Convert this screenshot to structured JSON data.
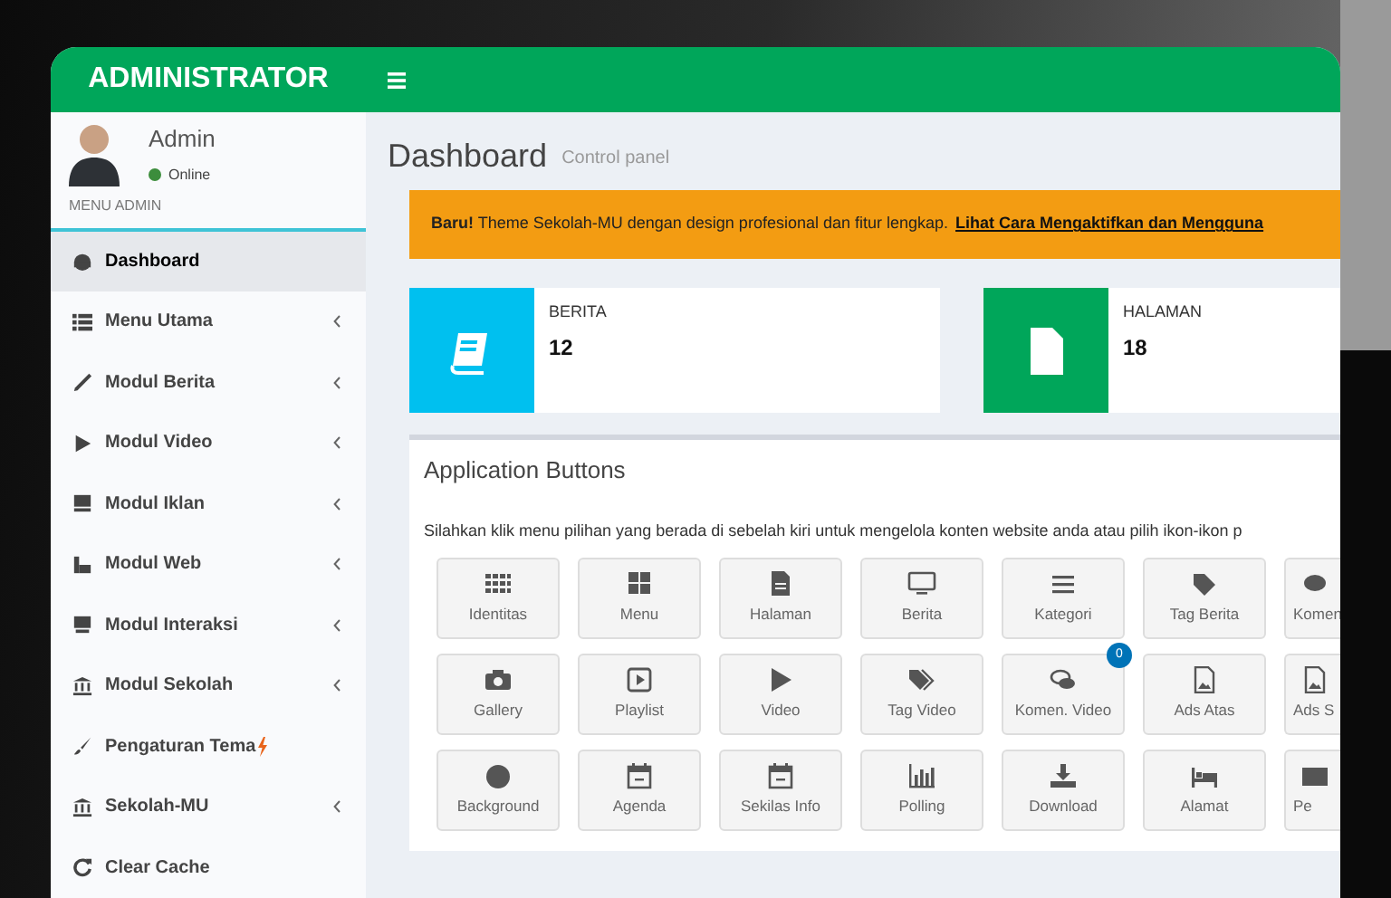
{
  "header": {
    "logo": "ADMINISTRATOR"
  },
  "user": {
    "name": "Admin",
    "status": "Online",
    "online": true
  },
  "sidebar": {
    "heading": "MENU ADMIN",
    "items": [
      {
        "label": "Dashboard",
        "kind": "link",
        "selected": true
      },
      {
        "label": "Menu Utama",
        "kind": "group",
        "selected": false
      },
      {
        "label": "Modul Berita",
        "kind": "group",
        "selected": false
      },
      {
        "label": "Modul Video",
        "kind": "group",
        "selected": false
      },
      {
        "label": "Modul Iklan",
        "kind": "group",
        "selected": false
      },
      {
        "label": "Modul Web",
        "kind": "group",
        "selected": false
      },
      {
        "label": "Modul Interaksi",
        "kind": "group",
        "selected": false
      },
      {
        "label": "Modul Sekolah",
        "kind": "group",
        "selected": false
      },
      {
        "label": "Pengaturan Tema",
        "kind": "flagged",
        "selected": false
      },
      {
        "label": "Sekolah-MU",
        "kind": "group",
        "selected": false
      },
      {
        "label": "Clear Cache",
        "kind": "link",
        "selected": false
      }
    ]
  },
  "page": {
    "title": "Dashboard",
    "subtitle": "Control panel"
  },
  "alert": {
    "text": "**Baru!** Theme Sekolah-MU dengan design profesional dan fitur lengkap.",
    "link": "Lihat Cara Mengaktifkan dan Mengguna"
  },
  "stats": [
    {
      "label": "BERITA",
      "value": "12",
      "color": "#00c0ef"
    },
    {
      "label": "HALAMAN",
      "value": "18",
      "color": "#00a65a"
    }
  ],
  "app_buttons": {
    "title": "Application Buttons",
    "intro": "Silahkan klik menu pilihan yang berada di sebelah kiri untuk mengelola konten website anda atau pilih ikon-ikon p",
    "rows": [
      [
        {
          "label": "Identitas"
        },
        {
          "label": "Menu"
        },
        {
          "label": "Halaman"
        },
        {
          "label": "Berita"
        },
        {
          "label": "Kategori"
        },
        {
          "label": "Tag Berita"
        },
        {
          "label": "Komen"
        }
      ],
      [
        {
          "label": "Gallery"
        },
        {
          "label": "Playlist"
        },
        {
          "label": "Video"
        },
        {
          "label": "Tag Video"
        },
        {
          "label": "Komen. Video",
          "badge": "0"
        },
        {
          "label": "Ads Atas"
        },
        {
          "label": "Ads S"
        }
      ],
      [
        {
          "label": "Background"
        },
        {
          "label": "Agenda"
        },
        {
          "label": "Sekilas Info"
        },
        {
          "label": "Polling"
        },
        {
          "label": "Download"
        },
        {
          "label": "Alamat"
        },
        {
          "label": "Pe"
        }
      ]
    ]
  }
}
